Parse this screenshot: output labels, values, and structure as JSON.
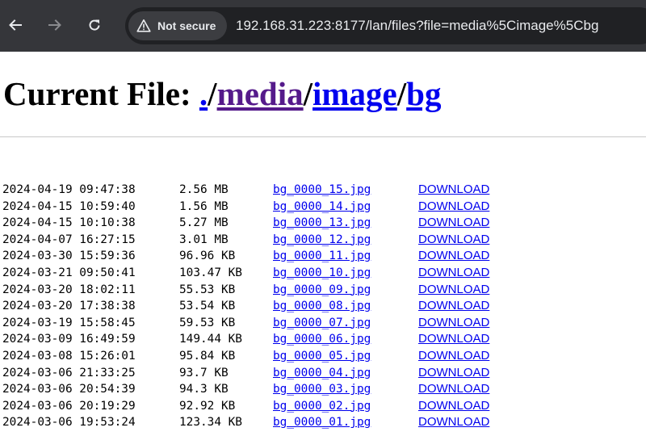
{
  "browser": {
    "security_label": "Not secure",
    "url": "192.168.31.223:8177/lan/files?file=media%5Cimage%5Cbg",
    "icons": [
      "back-arrow-icon",
      "forward-arrow-icon",
      "reload-icon",
      "warning-triangle-icon"
    ]
  },
  "header": {
    "prefix": "Current File: ",
    "crumbs": [
      {
        "label": "."
      },
      {
        "sep": "/"
      },
      {
        "label": "media"
      },
      {
        "sep": "/"
      },
      {
        "label": "image"
      },
      {
        "sep": "/"
      },
      {
        "label": "bg"
      }
    ]
  },
  "files": [
    {
      "date": "2024-04-19 09:47:38",
      "size": "2.56 MB",
      "name": "bg_0000_15.jpg",
      "action": "DOWNLOAD"
    },
    {
      "date": "2024-04-15 10:59:40",
      "size": "1.56 MB",
      "name": "bg_0000_14.jpg",
      "action": "DOWNLOAD"
    },
    {
      "date": "2024-04-15 10:10:38",
      "size": "5.27 MB",
      "name": "bg_0000_13.jpg",
      "action": "DOWNLOAD"
    },
    {
      "date": "2024-04-07 16:27:15",
      "size": "3.01 MB",
      "name": "bg_0000_12.jpg",
      "action": "DOWNLOAD"
    },
    {
      "date": "2024-03-30 15:59:36",
      "size": "96.96 KB",
      "name": "bg_0000_11.jpg",
      "action": "DOWNLOAD"
    },
    {
      "date": "2024-03-21 09:50:41",
      "size": "103.47 KB",
      "name": "bg_0000_10.jpg",
      "action": "DOWNLOAD"
    },
    {
      "date": "2024-03-20 18:02:11",
      "size": "55.53 KB",
      "name": "bg_0000_09.jpg",
      "action": "DOWNLOAD"
    },
    {
      "date": "2024-03-20 17:38:38",
      "size": "53.54 KB",
      "name": "bg_0000_08.jpg",
      "action": "DOWNLOAD"
    },
    {
      "date": "2024-03-19 15:58:45",
      "size": "59.53 KB",
      "name": "bg_0000_07.jpg",
      "action": "DOWNLOAD"
    },
    {
      "date": "2024-03-09 16:49:59",
      "size": "149.44 KB",
      "name": "bg_0000_06.jpg",
      "action": "DOWNLOAD"
    },
    {
      "date": "2024-03-08 15:26:01",
      "size": "95.84 KB",
      "name": "bg_0000_05.jpg",
      "action": "DOWNLOAD"
    },
    {
      "date": "2024-03-06 21:33:25",
      "size": "93.7 KB",
      "name": "bg_0000_04.jpg",
      "action": "DOWNLOAD"
    },
    {
      "date": "2024-03-06 20:54:39",
      "size": "94.3 KB",
      "name": "bg_0000_03.jpg",
      "action": "DOWNLOAD"
    },
    {
      "date": "2024-03-06 20:19:29",
      "size": "92.92 KB",
      "name": "bg_0000_02.jpg",
      "action": "DOWNLOAD"
    },
    {
      "date": "2024-03-06 19:53:24",
      "size": "123.34 KB",
      "name": "bg_0000_01.jpg",
      "action": "DOWNLOAD"
    }
  ]
}
